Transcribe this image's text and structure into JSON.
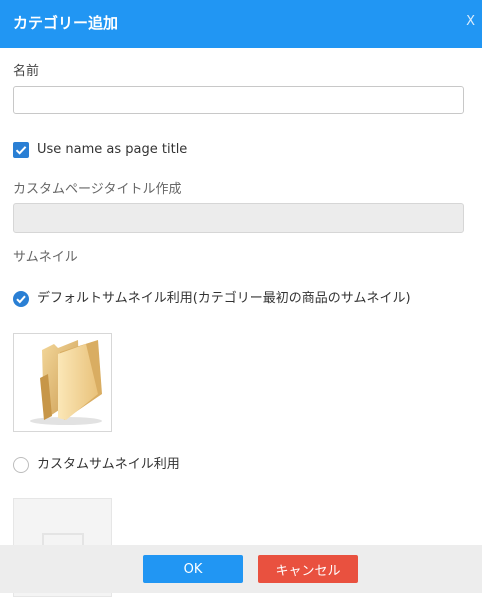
{
  "dialog": {
    "title": "カテゴリー追加",
    "close_label": "X"
  },
  "form": {
    "name_label": "名前",
    "name_value": "",
    "use_name_label": "Use name as page title",
    "use_name_checked": true,
    "custom_title_label": "カスタムページタイトル作成",
    "custom_title_value": "",
    "thumbnail_label": "サムネイル",
    "default_thumb_label": "デフォルトサムネイル利用(カテゴリー最初の商品のサムネイル)",
    "default_thumb_selected": true,
    "custom_thumb_label": "カスタムサムネイル利用",
    "custom_thumb_selected": false
  },
  "footer": {
    "ok_label": "OK",
    "cancel_label": "キャンセル"
  },
  "icons": {
    "checkbox": "checkmark-icon",
    "default_thumb": "folder-icon",
    "custom_thumb": "image-placeholder-icon"
  },
  "colors": {
    "header": "#2196f3",
    "ok": "#2196f3",
    "cancel": "#e9513f",
    "check": "#2a7fd4"
  }
}
